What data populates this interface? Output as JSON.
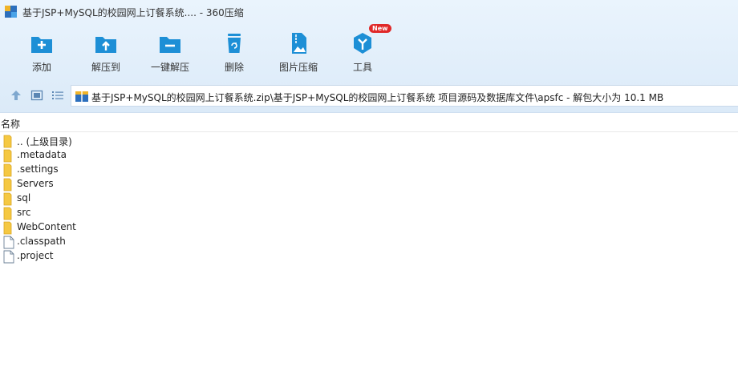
{
  "window": {
    "title": "基于JSP+MySQL的校园网上订餐系统.... - 360压缩"
  },
  "toolbar": {
    "items": [
      {
        "label": "添加",
        "icon": "add-icon"
      },
      {
        "label": "解压到",
        "icon": "extract-to-icon"
      },
      {
        "label": "一键解压",
        "icon": "one-click-extract-icon"
      },
      {
        "label": "删除",
        "icon": "delete-icon"
      },
      {
        "label": "图片压缩",
        "icon": "image-compress-icon"
      },
      {
        "label": "工具",
        "icon": "tools-icon",
        "badge": "New"
      }
    ]
  },
  "nav": {
    "path": "基于JSP+MySQL的校园网上订餐系统.zip\\基于JSP+MySQL的校园网上订餐系统 项目源码及数据库文件\\apsfc - 解包大小为 10.1 MB"
  },
  "columns": {
    "name": "名称"
  },
  "files": [
    {
      "name": ".. (上级目录)",
      "type": "folder"
    },
    {
      "name": ".metadata",
      "type": "folder"
    },
    {
      "name": ".settings",
      "type": "folder"
    },
    {
      "name": "Servers",
      "type": "folder"
    },
    {
      "name": "sql",
      "type": "folder"
    },
    {
      "name": "src",
      "type": "folder"
    },
    {
      "name": "WebContent",
      "type": "folder"
    },
    {
      "name": ".classpath",
      "type": "file"
    },
    {
      "name": ".project",
      "type": "file"
    }
  ],
  "colors": {
    "accent": "#1d8fd6",
    "folder": "#f5c842",
    "badge": "#e02929"
  }
}
